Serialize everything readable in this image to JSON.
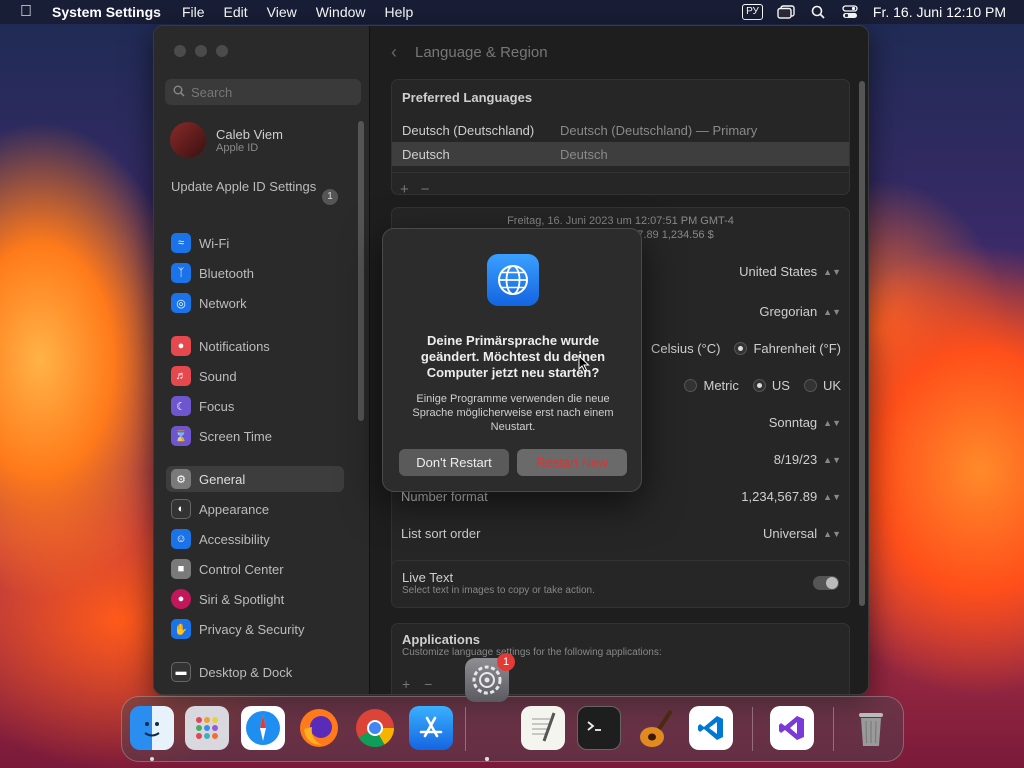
{
  "menubar": {
    "app_name": "System Settings",
    "menus": [
      "File",
      "Edit",
      "View",
      "Window",
      "Help"
    ],
    "input_source": "РУ",
    "datetime": "Fr. 16. Juni  12:10 PM"
  },
  "sidebar": {
    "search_placeholder": "Search",
    "profile_name": "Caleb Viem",
    "profile_sub": "Apple ID",
    "update_label": "Update Apple ID Settings",
    "update_count": "1",
    "items": [
      {
        "label": "Wi-Fi",
        "icon": "wifi-icon",
        "color": "#1a73e8"
      },
      {
        "label": "Bluetooth",
        "icon": "bluetooth-icon",
        "color": "#1a73e8"
      },
      {
        "label": "Network",
        "icon": "globe-icon",
        "color": "#1a73e8"
      },
      {
        "label": "Notifications",
        "icon": "bell-icon",
        "color": "#e5484d"
      },
      {
        "label": "Sound",
        "icon": "speaker-icon",
        "color": "#e5484d"
      },
      {
        "label": "Focus",
        "icon": "moon-icon",
        "color": "#6e56cf"
      },
      {
        "label": "Screen Time",
        "icon": "hourglass-icon",
        "color": "#6e56cf"
      },
      {
        "label": "General",
        "icon": "gear-icon",
        "color": "#7a7a7a"
      },
      {
        "label": "Appearance",
        "icon": "appearance-icon",
        "color": "#333333"
      },
      {
        "label": "Accessibility",
        "icon": "accessibility-icon",
        "color": "#1a73e8"
      },
      {
        "label": "Control Center",
        "icon": "control-center-icon",
        "color": "#7a7a7a"
      },
      {
        "label": "Siri & Spotlight",
        "icon": "siri-icon",
        "color": "#c2185b"
      },
      {
        "label": "Privacy & Security",
        "icon": "hand-icon",
        "color": "#1a73e8"
      },
      {
        "label": "Desktop & Dock",
        "icon": "dock-icon",
        "color": "#333333"
      }
    ]
  },
  "main": {
    "title": "Language & Region",
    "preferred_header": "Preferred Languages",
    "languages": [
      {
        "name": "Deutsch (Deutschland)",
        "detail": "Deutsch (Deutschland) — Primary"
      },
      {
        "name": "Deutsch",
        "detail": "Deutsch"
      }
    ],
    "sample_line1": "Freitag, 16. Juni 2023 um 12:07:51 PM GMT-4",
    "sample_line2": "7.89      1,234.56 $",
    "region_value": "United States",
    "calendar_value": "Gregorian",
    "temp_celsius": "Celsius (°C)",
    "temp_fahrenheit": "Fahrenheit (°F)",
    "measure_metric": "Metric",
    "measure_us": "US",
    "measure_uk": "UK",
    "first_day_value": "Sonntag",
    "date_format_value": "8/19/23",
    "number_format_label": "Number format",
    "number_format_value": "1,234,567.89",
    "sort_order_label": "List sort order",
    "sort_order_value": "Universal",
    "live_text_label": "Live Text",
    "live_text_sub": "Select text in images to copy or take action.",
    "apps_label": "Applications",
    "apps_sub": "Customize language settings for the following applications:"
  },
  "alert": {
    "title": "Deine Primärsprache wurde geändert. Möchtest du deinen Computer jetzt neu starten?",
    "body": "Einige Programme verwenden die neue Sprache möglicherweise erst nach einem Neustart.",
    "btn_dont": "Don't Restart",
    "btn_restart": "Restart Now"
  },
  "dock": {
    "notification_count": "1",
    "apps": [
      "Finder",
      "Launchpad",
      "Safari",
      "Firefox",
      "Chrome",
      "App Store",
      "TextEdit",
      "Terminal",
      "GarageBand",
      "VS Code",
      "Visual Studio",
      "Trash"
    ]
  }
}
